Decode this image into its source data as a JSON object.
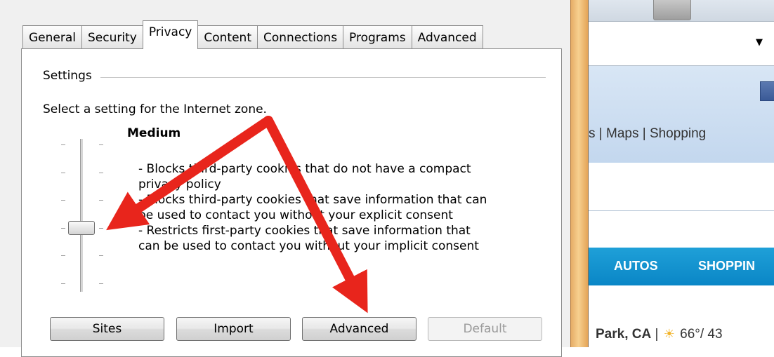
{
  "dialog": {
    "tabs": [
      {
        "label": "General"
      },
      {
        "label": "Security"
      },
      {
        "label": "Privacy"
      },
      {
        "label": "Content"
      },
      {
        "label": "Connections"
      },
      {
        "label": "Programs"
      },
      {
        "label": "Advanced"
      }
    ],
    "active_tab": "Privacy",
    "settings_group_label": "Settings",
    "select_text": "Select a setting for the Internet zone.",
    "slider": {
      "level_index": 3,
      "level_count": 6
    },
    "level_title": "Medium",
    "level_description": [
      "- Blocks third-party cookies that do not have a compact",
      "privacy policy",
      "- Blocks third-party cookies that save information that can",
      "be used to contact you without your explicit consent",
      "- Restricts first-party cookies that save information that",
      "can be used to contact you without your implicit consent"
    ],
    "buttons": {
      "sites": "Sites",
      "import": "Import",
      "advanced": "Advanced",
      "default": "Default"
    }
  },
  "browser_bg": {
    "nav_links": "s | Maps | Shopping",
    "section_nav": [
      "AUTOS",
      "SHOPPIN"
    ],
    "location": "Park, CA",
    "separator": "|",
    "weather_temp": "66°/ 43"
  },
  "annotation": {
    "arrow_color": "#e8251c",
    "targets": [
      "privacy-slider-thumb",
      "advanced-button"
    ]
  },
  "colors": {
    "dialog_bg": "#f0f0f0",
    "frame_accent": "#f2c37e",
    "browser_nav_blue": "#0a86c6"
  }
}
